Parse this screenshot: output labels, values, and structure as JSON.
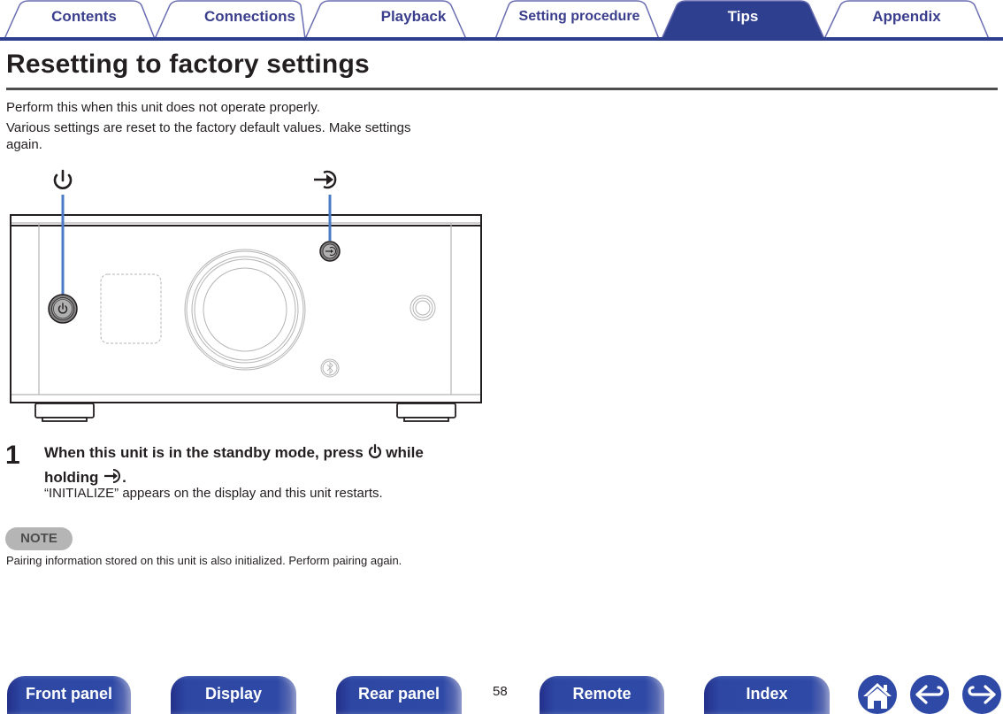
{
  "tabs": [
    {
      "label": "Contents",
      "active": false
    },
    {
      "label": "Connections",
      "active": false
    },
    {
      "label": "Playback",
      "active": false
    },
    {
      "label": "Setting procedure",
      "active": false
    },
    {
      "label": "Tips",
      "active": true
    },
    {
      "label": "Appendix",
      "active": false
    }
  ],
  "page": {
    "title": "Resetting to factory settings",
    "intro": [
      "Perform this when this unit does not operate properly.",
      "Various settings are reset to the factory default values. Make settings",
      "again."
    ]
  },
  "illustration": {
    "callouts": [
      {
        "icon": "power-icon"
      },
      {
        "icon": "input-source-icon"
      }
    ],
    "controls": [
      "power-button",
      "input-button",
      "volume-knob",
      "display-window",
      "bluetooth-button",
      "headphone-jack"
    ]
  },
  "step": {
    "number": "1",
    "text_part1": "When this unit is in the standby mode, press",
    "text_part2": "while",
    "text_part3": "holding",
    "text_part4": ".",
    "result": "“INITIALIZE” appears on the display and this unit restarts."
  },
  "note": {
    "badge": "NOTE",
    "text": "Pairing information stored on this unit is also initialized. Perform pairing again."
  },
  "footer": {
    "buttons": [
      "Front panel",
      "Display",
      "Rear panel",
      "Remote",
      "Index"
    ],
    "page_number": "58",
    "icons": [
      "home-icon",
      "back-arrow-icon",
      "forward-arrow-icon"
    ]
  },
  "colors": {
    "brand_blue": "#2e3f8f",
    "tab_outline": "#5a5fa8",
    "callout_line": "#4a7bc4"
  }
}
